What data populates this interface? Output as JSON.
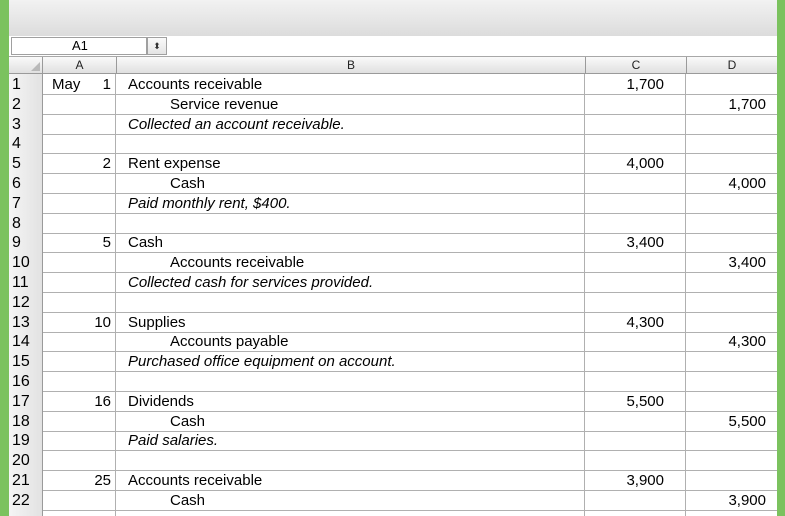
{
  "name_box": {
    "value": "A1",
    "stepper_glyph": "⬍"
  },
  "columns": [
    "A",
    "B",
    "C",
    "D"
  ],
  "rows": [
    {
      "num": "1",
      "month": "May",
      "day": "1",
      "account": "Accounts receivable",
      "style": "debit",
      "debit": "1,700",
      "credit": ""
    },
    {
      "num": "2",
      "month": "",
      "day": "",
      "account": "Service revenue",
      "style": "credit",
      "debit": "",
      "credit": "1,700"
    },
    {
      "num": "3",
      "month": "",
      "day": "",
      "account": "Collected an account receivable.",
      "style": "explain",
      "debit": "",
      "credit": ""
    },
    {
      "num": "4",
      "month": "",
      "day": "",
      "account": "",
      "style": "blank",
      "debit": "",
      "credit": ""
    },
    {
      "num": "5",
      "month": "",
      "day": "2",
      "account": "Rent expense",
      "style": "debit",
      "debit": "4,000",
      "credit": ""
    },
    {
      "num": "6",
      "month": "",
      "day": "",
      "account": "Cash",
      "style": "credit",
      "debit": "",
      "credit": "4,000"
    },
    {
      "num": "7",
      "month": "",
      "day": "",
      "account": "Paid monthly rent, $400.",
      "style": "explain",
      "debit": "",
      "credit": ""
    },
    {
      "num": "8",
      "month": "",
      "day": "",
      "account": "",
      "style": "blank",
      "debit": "",
      "credit": ""
    },
    {
      "num": "9",
      "month": "",
      "day": "5",
      "account": "Cash",
      "style": "debit",
      "debit": "3,400",
      "credit": ""
    },
    {
      "num": "10",
      "month": "",
      "day": "",
      "account": "Accounts receivable",
      "style": "credit",
      "debit": "",
      "credit": "3,400"
    },
    {
      "num": "11",
      "month": "",
      "day": "",
      "account": "Collected cash for services provided.",
      "style": "explain",
      "debit": "",
      "credit": ""
    },
    {
      "num": "12",
      "month": "",
      "day": "",
      "account": "",
      "style": "blank",
      "debit": "",
      "credit": ""
    },
    {
      "num": "13",
      "month": "",
      "day": "10",
      "account": "Supplies",
      "style": "debit",
      "debit": "4,300",
      "credit": ""
    },
    {
      "num": "14",
      "month": "",
      "day": "",
      "account": "Accounts payable",
      "style": "credit",
      "debit": "",
      "credit": "4,300"
    },
    {
      "num": "15",
      "month": "",
      "day": "",
      "account": "Purchased office equipment on account.",
      "style": "explain",
      "debit": "",
      "credit": ""
    },
    {
      "num": "16",
      "month": "",
      "day": "",
      "account": "",
      "style": "blank",
      "debit": "",
      "credit": ""
    },
    {
      "num": "17",
      "month": "",
      "day": "16",
      "account": "Dividends",
      "style": "debit",
      "debit": "5,500",
      "credit": ""
    },
    {
      "num": "18",
      "month": "",
      "day": "",
      "account": "Cash",
      "style": "credit",
      "debit": "",
      "credit": "5,500"
    },
    {
      "num": "19",
      "month": "",
      "day": "",
      "account": "Paid salaries.",
      "style": "explain",
      "debit": "",
      "credit": ""
    },
    {
      "num": "20",
      "month": "",
      "day": "",
      "account": "",
      "style": "blank",
      "debit": "",
      "credit": ""
    },
    {
      "num": "21",
      "month": "",
      "day": "25",
      "account": "Accounts receivable",
      "style": "debit",
      "debit": "3,900",
      "credit": ""
    },
    {
      "num": "22",
      "month": "",
      "day": "",
      "account": "Cash",
      "style": "credit",
      "debit": "",
      "credit": "3,900"
    },
    {
      "num": "",
      "month": "",
      "day": "",
      "account": "",
      "style": "blank",
      "debit": "",
      "credit": ""
    }
  ]
}
